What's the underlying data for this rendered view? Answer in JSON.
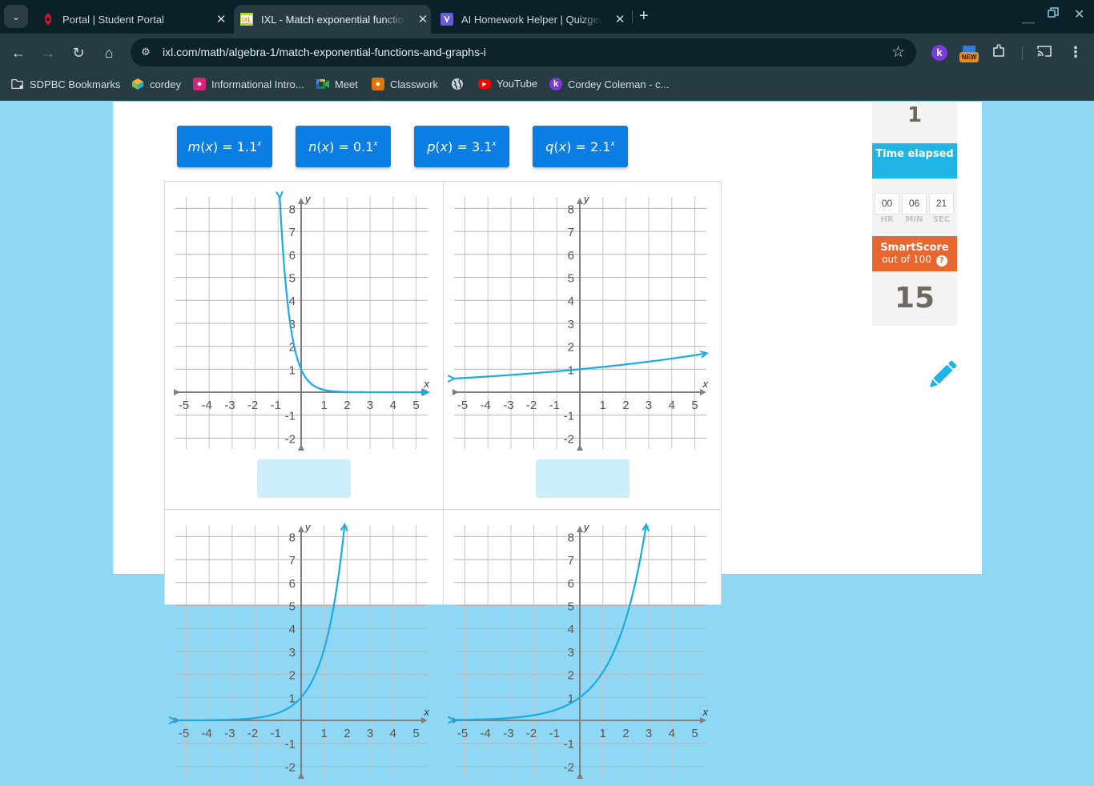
{
  "browser": {
    "tabs": [
      {
        "title": "Portal | Student Portal",
        "icon": "portal-shield-icon",
        "active": false
      },
      {
        "title": "IXL - Match exponential functions and graphs",
        "icon": "ixl-logo-icon",
        "active": true
      },
      {
        "title": "AI Homework Helper | Quizgecko",
        "icon": "quizgecko-icon",
        "active": false
      }
    ],
    "url": "ixl.com/math/algebra-1/match-exponential-functions-and-graphs-i",
    "extensions": {
      "new_badge": "NEW",
      "k_label": "k"
    },
    "bookmarks": [
      {
        "label": "SDPBC Bookmarks",
        "icon": "folder-icon"
      },
      {
        "label": "cordey",
        "icon": "cube-icon"
      },
      {
        "label": "Informational Intro...",
        "icon": "classroom-icon"
      },
      {
        "label": "Meet",
        "icon": "meet-icon"
      },
      {
        "label": "Classwork",
        "icon": "classwork-icon"
      },
      {
        "label": "",
        "icon": "globe-icon"
      },
      {
        "label": "YouTube",
        "icon": "youtube-icon"
      },
      {
        "label": "Cordey Coleman - c...",
        "icon": "k-icon"
      }
    ]
  },
  "problem": {
    "functions": [
      {
        "name": "m",
        "var": "x",
        "base": "1.1",
        "exp": "x"
      },
      {
        "name": "n",
        "var": "x",
        "base": "0.1",
        "exp": "x"
      },
      {
        "name": "p",
        "var": "x",
        "base": "3.1",
        "exp": "x"
      },
      {
        "name": "q",
        "var": "x",
        "base": "2.1",
        "exp": "x"
      }
    ],
    "graphs": [
      {
        "base": 0.1,
        "answer": ""
      },
      {
        "base": 1.1,
        "answer": ""
      },
      {
        "base": 3.1,
        "answer": ""
      },
      {
        "base": 2.1,
        "answer": ""
      }
    ],
    "axis": {
      "x_label": "x",
      "y_label": "y",
      "x_ticks": [
        "-5",
        "-4",
        "-3",
        "-2",
        "-1",
        "1",
        "2",
        "3",
        "4",
        "5"
      ],
      "y_ticks": [
        "8",
        "7",
        "6",
        "5",
        "4",
        "3",
        "2",
        "1",
        "-1",
        "-2"
      ],
      "xlim": [
        -5,
        5
      ],
      "ylim": [
        -2,
        8
      ]
    },
    "curve_color": "#1aabe6"
  },
  "sidebar": {
    "questions_answered": "1",
    "time_header": "Time elapsed",
    "time": {
      "hr": "00",
      "min": "06",
      "sec": "21"
    },
    "time_labels": {
      "hr": "HR",
      "min": "MIN",
      "sec": "SEC"
    },
    "smartscore_title": "SmartScore",
    "smartscore_sub": "out of 100",
    "help_glyph": "?",
    "smartscore": "15"
  }
}
